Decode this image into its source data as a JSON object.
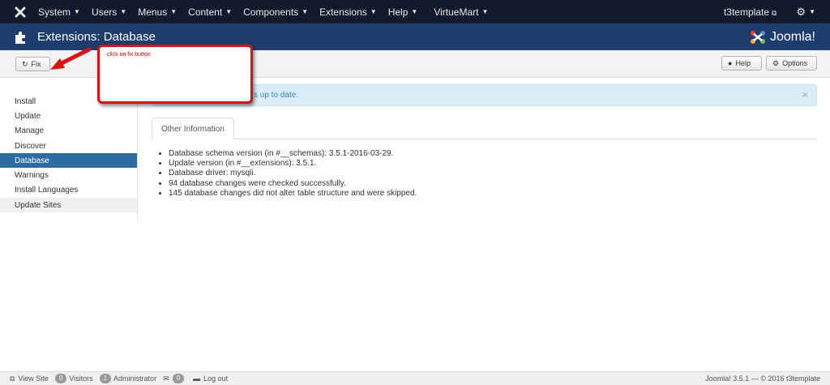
{
  "topnav": {
    "menus": [
      "System",
      "Users",
      "Menus",
      "Content",
      "Components",
      "Extensions",
      "Help",
      "VirtueMart"
    ],
    "site_link": "t3template"
  },
  "title": {
    "text": "Extensions: Database",
    "brand": "Joomla!"
  },
  "toolbar": {
    "fix_label": "Fix",
    "help_label": "Help",
    "options_label": "Options"
  },
  "callout": {
    "text": "click on fix button"
  },
  "sidebar": {
    "items": [
      {
        "label": "Install"
      },
      {
        "label": "Update"
      },
      {
        "label": "Manage"
      },
      {
        "label": "Discover"
      },
      {
        "label": "Database"
      },
      {
        "label": "Warnings"
      },
      {
        "label": "Install Languages"
      },
      {
        "label": "Update Sites"
      }
    ],
    "active": "Database"
  },
  "alert": {
    "text": "s up to date.",
    "close": "×"
  },
  "tabs": [
    {
      "label": "Other Information"
    }
  ],
  "info": [
    "Database schema version (in #__schemas): 3.5.1-2016-03-29.",
    "Update version (in #__extensions): 3.5.1.",
    "Database driver: mysqli.",
    "94 database changes were checked successfully.",
    "145 database changes did not alter table structure and were skipped."
  ],
  "footer": {
    "view_site": "View Site",
    "visitors_count": "0",
    "visitors_label": "Visitors",
    "admins_count": "1",
    "admins_label": "Administrator",
    "messages_count": "0",
    "logout": "Log out",
    "copyright": "Joomla! 3.5.1 — © 2016 t3template"
  },
  "colors": {
    "nav_bg": "#111b2c",
    "title_bg": "#1c3d6e",
    "active_bg": "#2d6ca2",
    "alert_bg": "#d9edf7",
    "callout_border": "#e01010"
  }
}
